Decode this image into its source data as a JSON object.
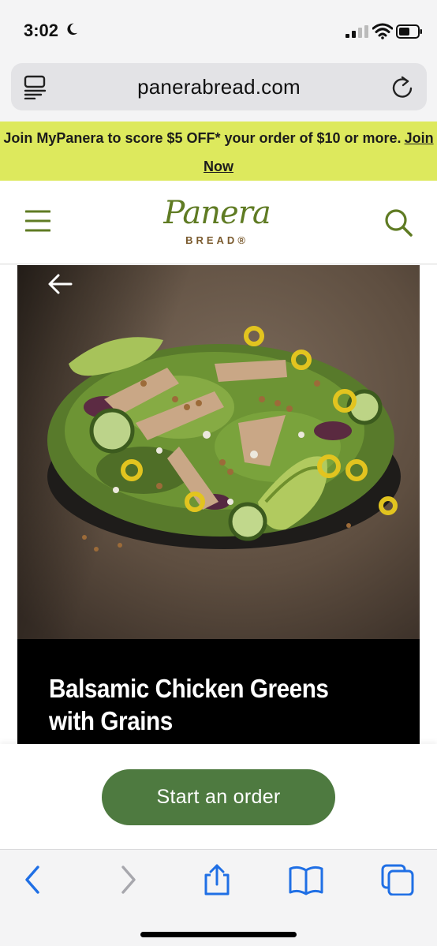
{
  "status_bar": {
    "time": "3:02"
  },
  "browser": {
    "url": "panerabread.com"
  },
  "promo": {
    "text": "Join MyPanera to score $5 OFF* your order of $10 or more.",
    "link": "Join Now"
  },
  "header": {
    "logo_word": "Panera",
    "logo_sub": "BREAD®"
  },
  "product": {
    "title": "Balsamic Chicken Greens with Grains"
  },
  "cta": {
    "label": "Start an order"
  },
  "colors": {
    "promo_bg": "#dde95d",
    "brand_green": "#5f7b23",
    "cta_green": "#4e7a40"
  }
}
